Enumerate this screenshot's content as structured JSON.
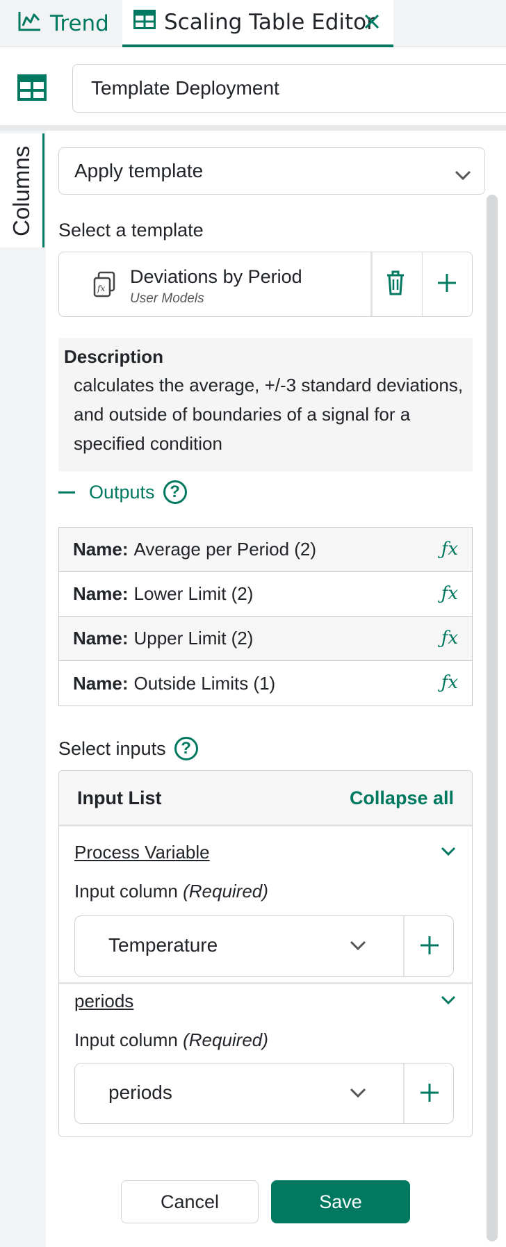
{
  "tabs": {
    "trend_label": "Trend",
    "editor_label": "Scaling Table Editor"
  },
  "header": {
    "table_name": "Template Deployment"
  },
  "rail": {
    "columns_label": "Columns"
  },
  "mode_select": {
    "value": "Apply template"
  },
  "template": {
    "section_label": "Select a template",
    "name": "Deviations by Period",
    "source": "User Models"
  },
  "description": {
    "title": "Description",
    "text": "calculates the average, +/-3 standard deviations, and outside of boundaries of a signal for a specified condition"
  },
  "outputs": {
    "label": "Outputs",
    "help_glyph": "?",
    "name_prefix": "Name:",
    "fx_glyph": "ƒx",
    "rows": [
      {
        "name": "Average per Period (2)"
      },
      {
        "name": "Lower Limit (2)"
      },
      {
        "name": "Upper Limit (2)"
      },
      {
        "name": "Outside Limits (1)"
      }
    ]
  },
  "inputs": {
    "label": "Select inputs",
    "help_glyph": "?",
    "list_title": "Input List",
    "collapse_all": "Collapse all",
    "column_label": "Input column ",
    "required_label": "(Required)",
    "items": [
      {
        "name": "Process Variable",
        "value": "Temperature"
      },
      {
        "name": "periods",
        "value": "periods"
      }
    ]
  },
  "actions": {
    "cancel_label": "Cancel",
    "save_label": "Save"
  },
  "colors": {
    "accent": "#007960",
    "panel_bg": "#f2f3f4",
    "description_bg": "#f5f5f5"
  }
}
